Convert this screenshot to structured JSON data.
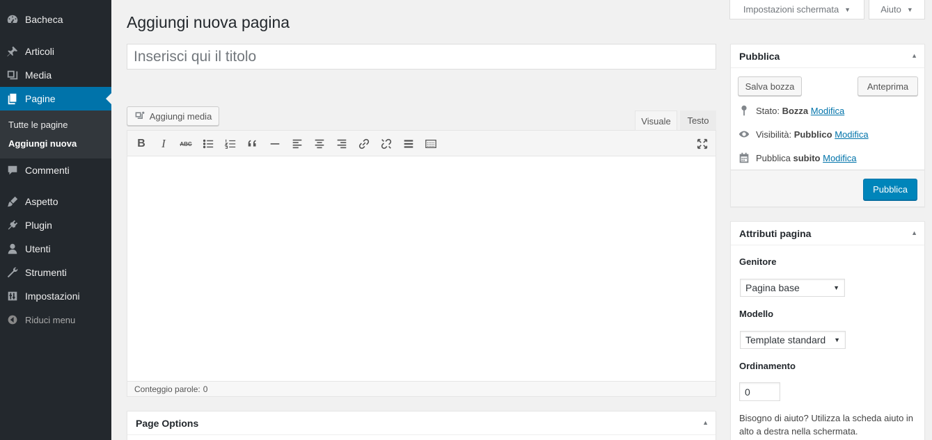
{
  "sidebar": {
    "items": [
      {
        "label": "Bacheca",
        "icon": "dashboard-icon"
      },
      {
        "label": "Articoli",
        "icon": "pushpin-icon"
      },
      {
        "label": "Media",
        "icon": "media-icon"
      },
      {
        "label": "Pagine",
        "icon": "pages-icon"
      },
      {
        "label": "Commenti",
        "icon": "comments-icon"
      },
      {
        "label": "Aspetto",
        "icon": "appearance-icon"
      },
      {
        "label": "Plugin",
        "icon": "plugin-icon"
      },
      {
        "label": "Utenti",
        "icon": "users-icon"
      },
      {
        "label": "Strumenti",
        "icon": "tools-icon"
      },
      {
        "label": "Impostazioni",
        "icon": "settings-icon"
      }
    ],
    "submenu": [
      "Tutte le pagine",
      "Aggiungi nuova"
    ],
    "collapse_label": "Riduci menu",
    "accent_color": "#0073aa"
  },
  "top_tabs": {
    "screen_options": "Impostazioni schermata",
    "help": "Aiuto"
  },
  "page_title": "Aggiungi nuova pagina",
  "title_input": {
    "placeholder": "Inserisci qui il titolo",
    "value": ""
  },
  "editor": {
    "add_media_label": "Aggiungi media",
    "tab_visual": "Visuale",
    "tab_text": "Testo",
    "toolbar": {
      "bold": "B",
      "italic": "I",
      "strike": "ABC"
    },
    "word_count_label": "Conteggio parole:",
    "word_count": "0"
  },
  "page_options": {
    "title": "Page Options"
  },
  "publish_box": {
    "title": "Pubblica",
    "save_draft": "Salva bozza",
    "preview": "Anteprima",
    "status_label": "Stato:",
    "status_value": "Bozza",
    "visibility_label": "Visibilità:",
    "visibility_value": "Pubblico",
    "publish_label": "Pubblica",
    "publish_value": "subito",
    "edit_link": "Modifica",
    "publish_button": "Pubblica",
    "button_color": "#0085ba"
  },
  "attributes_box": {
    "title": "Attributi pagina",
    "parent_label": "Genitore",
    "parent_value": "Pagina base",
    "template_label": "Modello",
    "template_value": "Template standard",
    "order_label": "Ordinamento",
    "order_value": "0",
    "help_text": "Bisogno di aiuto? Utilizza la scheda aiuto in alto a destra nella schermata."
  }
}
